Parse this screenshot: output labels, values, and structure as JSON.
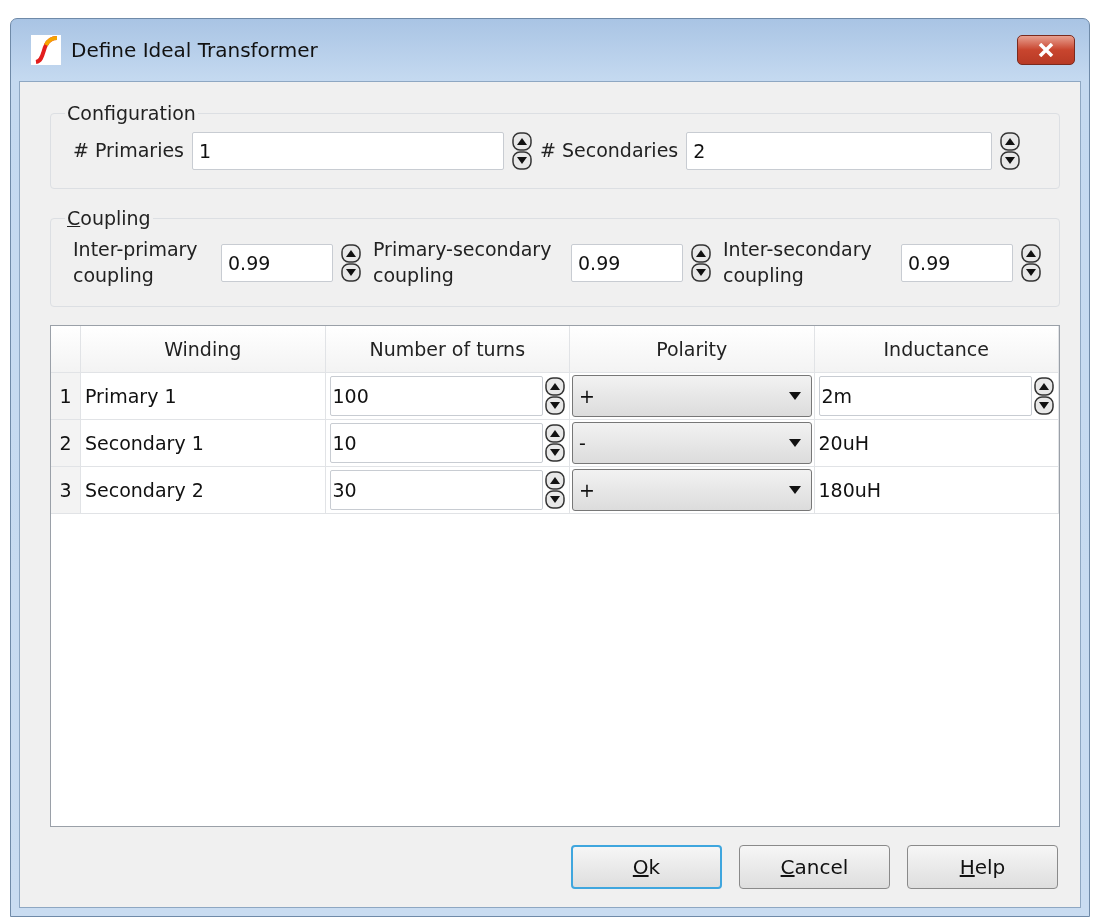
{
  "window": {
    "title": "Define Ideal Transformer"
  },
  "configuration": {
    "title": "Configuration",
    "mnemonic": false,
    "fields": [
      {
        "label": "# Primaries",
        "value": "1"
      },
      {
        "label": "# Secondaries",
        "value": "2"
      }
    ]
  },
  "coupling": {
    "title": "Coupling",
    "mnemonic": true,
    "fields": [
      {
        "label": "Inter-primary coupling",
        "value": "0.99"
      },
      {
        "label": "Primary-secondary coupling",
        "value": "0.99"
      },
      {
        "label": "Inter-secondary coupling",
        "value": "0.99"
      }
    ]
  },
  "table": {
    "columns": [
      "Winding",
      "Number of turns",
      "Polarity",
      "Inductance"
    ],
    "rows": [
      {
        "index": "1",
        "winding": "Primary 1",
        "turns": "100",
        "polarity": "+",
        "inductance": "2m",
        "editing": true
      },
      {
        "index": "2",
        "winding": "Secondary 1",
        "turns": "10",
        "polarity": "-",
        "inductance": "20uH",
        "editing": false
      },
      {
        "index": "3",
        "winding": "Secondary 2",
        "turns": "30",
        "polarity": "+",
        "inductance": "180uH",
        "editing": false
      }
    ]
  },
  "buttons": [
    {
      "label": "Ok",
      "default": true,
      "mnemonic": true
    },
    {
      "label": "Cancel",
      "default": false,
      "mnemonic": true
    },
    {
      "label": "Help",
      "default": false,
      "mnemonic": true
    }
  ]
}
